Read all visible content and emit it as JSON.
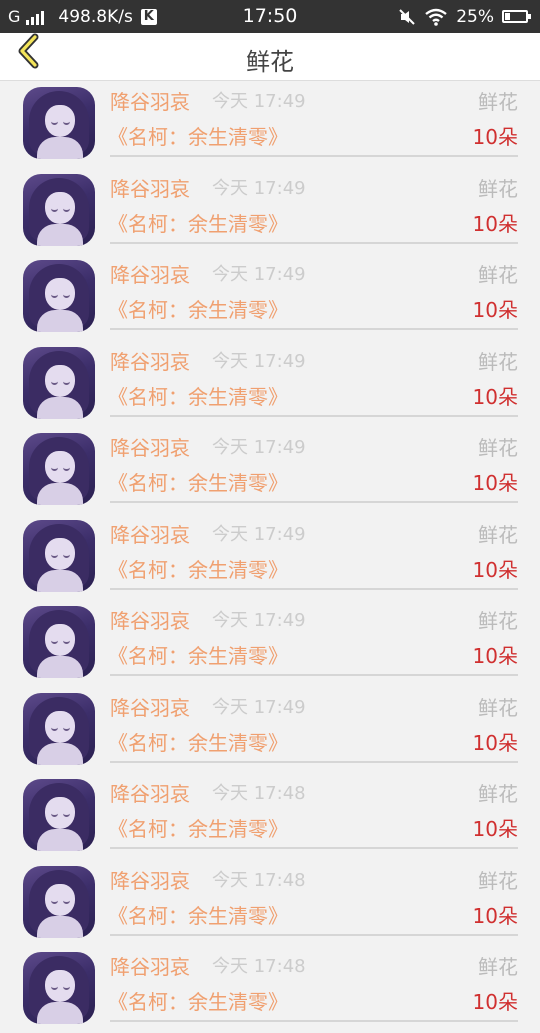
{
  "status_bar": {
    "network": "G",
    "speed": "498.8K/s",
    "app_badge": "K",
    "time": "17:50",
    "battery": "25%"
  },
  "header": {
    "title": "鲜花"
  },
  "colors": {
    "name": "#f0a070",
    "time": "#cccccc",
    "count": "#d03030",
    "gift_type": "#bbbbbb"
  },
  "entries": [
    {
      "user": "降谷羽哀",
      "time": "今天 17:49",
      "gift": "鲜花",
      "book": "《名柯：余生清零》",
      "count": "10朵"
    },
    {
      "user": "降谷羽哀",
      "time": "今天 17:49",
      "gift": "鲜花",
      "book": "《名柯：余生清零》",
      "count": "10朵"
    },
    {
      "user": "降谷羽哀",
      "time": "今天 17:49",
      "gift": "鲜花",
      "book": "《名柯：余生清零》",
      "count": "10朵"
    },
    {
      "user": "降谷羽哀",
      "time": "今天 17:49",
      "gift": "鲜花",
      "book": "《名柯：余生清零》",
      "count": "10朵"
    },
    {
      "user": "降谷羽哀",
      "time": "今天 17:49",
      "gift": "鲜花",
      "book": "《名柯：余生清零》",
      "count": "10朵"
    },
    {
      "user": "降谷羽哀",
      "time": "今天 17:49",
      "gift": "鲜花",
      "book": "《名柯：余生清零》",
      "count": "10朵"
    },
    {
      "user": "降谷羽哀",
      "time": "今天 17:49",
      "gift": "鲜花",
      "book": "《名柯：余生清零》",
      "count": "10朵"
    },
    {
      "user": "降谷羽哀",
      "time": "今天 17:49",
      "gift": "鲜花",
      "book": "《名柯：余生清零》",
      "count": "10朵"
    },
    {
      "user": "降谷羽哀",
      "time": "今天 17:48",
      "gift": "鲜花",
      "book": "《名柯：余生清零》",
      "count": "10朵"
    },
    {
      "user": "降谷羽哀",
      "time": "今天 17:48",
      "gift": "鲜花",
      "book": "《名柯：余生清零》",
      "count": "10朵"
    },
    {
      "user": "降谷羽哀",
      "time": "今天 17:48",
      "gift": "鲜花",
      "book": "《名柯：余生清零》",
      "count": "10朵"
    }
  ]
}
